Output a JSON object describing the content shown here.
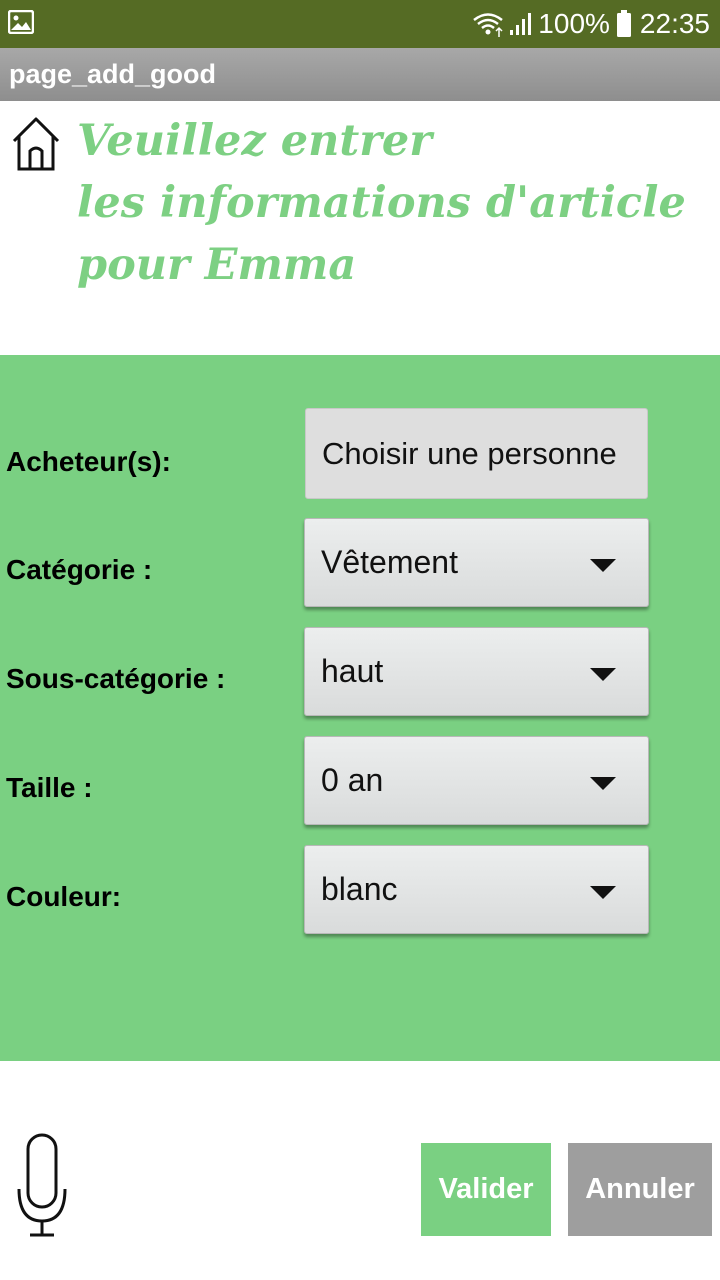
{
  "status_bar": {
    "notification_icon": "image-icon",
    "wifi_icon": "wifi-icon",
    "signal_icon": "signal-icon",
    "battery_text": "100%",
    "battery_icon": "battery-icon",
    "time": "22:35",
    "color": "#556b24"
  },
  "title_bar": {
    "title": "page_add_good"
  },
  "header": {
    "home_icon": "home-icon",
    "lines": [
      "Veuillez entrer",
      "les informations d'article",
      "pour Emma"
    ],
    "color": "#7dd083"
  },
  "form": {
    "background": "#7ad082",
    "buyer": {
      "label": "Acheteur(s):",
      "button_label": "Choisir une personne"
    },
    "category": {
      "label": "Catégorie :",
      "value": "Vêtement"
    },
    "subcategory": {
      "label": "Sous-catégorie :",
      "value": "haut"
    },
    "size": {
      "label": "Taille :",
      "value": "0 an"
    },
    "color": {
      "label": "Couleur:",
      "value": "blanc"
    }
  },
  "footer": {
    "mic_icon": "microphone-icon",
    "validate_label": "Valider",
    "cancel_label": "Annuler"
  }
}
